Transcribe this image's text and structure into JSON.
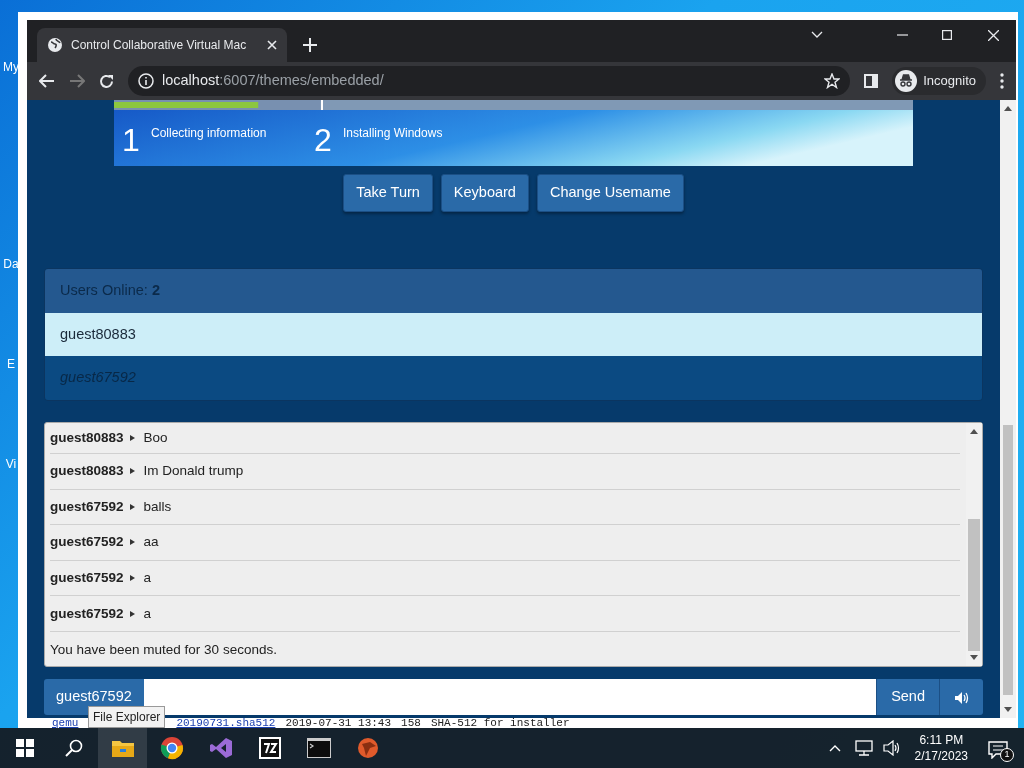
{
  "desktop": {
    "icons": [
      {
        "label": "My"
      },
      {
        "label": "Da"
      },
      {
        "label": "E"
      },
      {
        "label": "Vi"
      }
    ]
  },
  "background_window": {
    "cells": [
      "qemu",
      "20190731.sha512",
      "2019-07-31 13:43",
      "158",
      "SHA-512 for installer"
    ]
  },
  "browser": {
    "tab_title": "Control Collaborative Virtual Mac",
    "url_host": "localhost",
    "url_rest": ":6007/themes/embedded/",
    "profile": "Incognito"
  },
  "vm_screen": {
    "progress": {
      "level": 0.7
    },
    "steps": [
      {
        "number": "1",
        "label": "Collecting information"
      },
      {
        "number": "2",
        "label": "Installing Windows"
      }
    ]
  },
  "buttons": [
    "Take Turn",
    "Keyboard",
    "Change Usemame"
  ],
  "users": {
    "heading": "Users Online:",
    "count": "2",
    "list": [
      {
        "name": "guest80883",
        "selected": true,
        "self": false
      },
      {
        "name": "guest67592",
        "selected": false,
        "self": true
      }
    ]
  },
  "chat": {
    "messages": [
      {
        "user": "guest80883",
        "text": "Boo"
      },
      {
        "user": "guest80883",
        "text": "Im Donald trump"
      },
      {
        "user": "guest67592",
        "text": "balls"
      },
      {
        "user": "guest67592",
        "text": "aa"
      },
      {
        "user": "guest67592",
        "text": "a"
      },
      {
        "user": "guest67592",
        "text": "a"
      }
    ],
    "notice": "You have been muted for 30 seconds."
  },
  "input": {
    "username": "guest67592",
    "send": "Send"
  },
  "taskbar": {
    "tooltip": "File Explorer",
    "time": "6:11 PM",
    "date": "2/17/2023",
    "notifications": "1"
  }
}
